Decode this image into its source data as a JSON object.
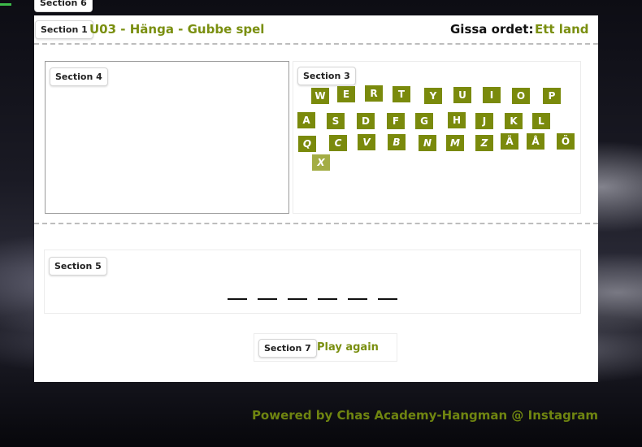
{
  "sections": {
    "s1": "Section 1",
    "s3": "Section 3",
    "s4": "Section 4",
    "s5": "Section 5",
    "s6": "Section 6",
    "s7": "Section 7"
  },
  "header": {
    "title": "U03 - Hänga - Gubbe spel",
    "guess_label": "Gissa ordet:",
    "guess_hint": "Ett land"
  },
  "keyboard": {
    "row1": [
      "W",
      "E",
      "R",
      "T",
      "Y",
      "U",
      "I",
      "O",
      "P"
    ],
    "row2": [
      "A",
      "S",
      "D",
      "F",
      "G",
      "H",
      "J",
      "K",
      "L"
    ],
    "row3": [
      "Q",
      "C",
      "V",
      "B",
      "N",
      "M",
      "Z",
      "Ä",
      "Å",
      "Ö"
    ],
    "row4": [
      "X"
    ]
  },
  "word": {
    "letter_count": 6
  },
  "actions": {
    "play_again": "Play again"
  },
  "footer": "Powered by Chas Academy-Hangman @ Instagram",
  "colors": {
    "accent": "#7a8f10",
    "key": "#7a8a0c"
  }
}
